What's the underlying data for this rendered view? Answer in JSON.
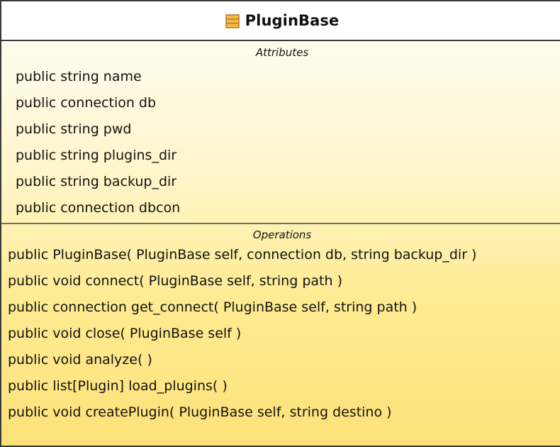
{
  "class_box": {
    "title": "PluginBase",
    "icon": "class-icon",
    "attributes_label": "Attributes",
    "operations_label": "Operations",
    "attributes": [
      "public string name",
      "public connection db",
      "public string pwd",
      "public string plugins_dir",
      "public string backup_dir",
      "public connection dbcon"
    ],
    "operations": [
      "public PluginBase( PluginBase self, connection db, string backup_dir )",
      "public void  connect( PluginBase self, string path )",
      "public connection  get_connect( PluginBase self, string path )",
      "public void  close( PluginBase self )",
      "public void  analyze(  )",
      "public list[Plugin]  load_plugins(  )",
      "public void  createPlugin( PluginBase self, string destino )"
    ]
  },
  "colors": {
    "border": "#3a3a3a",
    "header_background": "#ffffff",
    "gradient_end": "#fde27b",
    "icon_fill": "#f4b94c",
    "icon_stroke": "#b77a1a"
  }
}
